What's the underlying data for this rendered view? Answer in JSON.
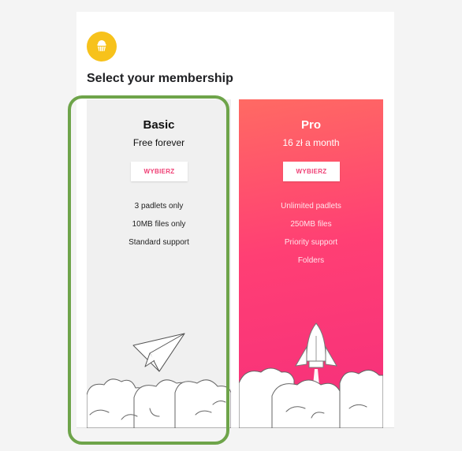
{
  "title": "Select your membership",
  "plans": [
    {
      "name": "Basic",
      "price": "Free forever",
      "button_label": "WYBIERZ",
      "features": [
        "3 padlets only",
        "10MB files only",
        "Standard support"
      ]
    },
    {
      "name": "Pro",
      "price": "16 zł a month",
      "button_label": "WYBIERZ",
      "features": [
        "Unlimited padlets",
        "250MB files",
        "Priority support",
        "Folders"
      ]
    }
  ],
  "icons": {
    "logo": "muffin-icon",
    "basic_illustration": "paper-plane-icon",
    "pro_illustration": "rocket-icon",
    "clouds": "clouds-icon"
  },
  "colors": {
    "accent": "#f7c21b",
    "pro_gradient_start": "#ff6a63",
    "pro_gradient_end": "#f52e7c",
    "button_text": "#ef3e74",
    "highlight": "#6ea44a"
  }
}
